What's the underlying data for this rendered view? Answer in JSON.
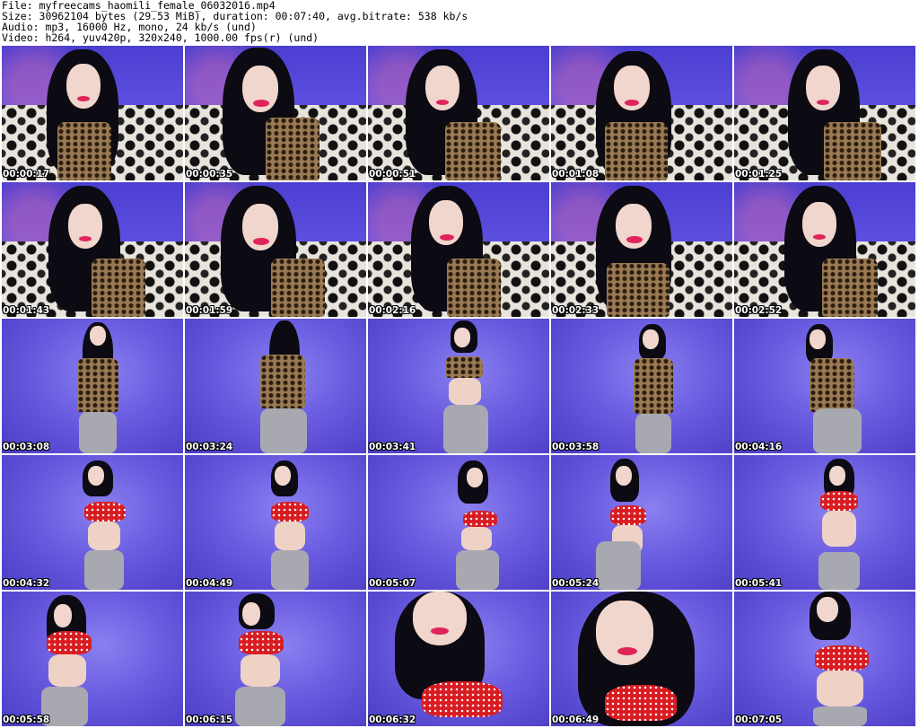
{
  "header": {
    "line1": "File: myfreecams_haomili_female_06032016.mp4",
    "line2": "Size: 30962104 bytes (29.53 MiB), duration: 00:07:40, avg.bitrate: 538 kb/s",
    "line3": "Audio: mp3, 16000 Hz, mono, 24 kb/s (und)",
    "line4": "Video: h264, yuv420p, 320x240, 1000.00 fps(r) (und)"
  },
  "thumbnails": [
    {
      "time": "00:00:17"
    },
    {
      "time": "00:00:35"
    },
    {
      "time": "00:00:51"
    },
    {
      "time": "00:01:08"
    },
    {
      "time": "00:01:25"
    },
    {
      "time": "00:01:43"
    },
    {
      "time": "00:01:59"
    },
    {
      "time": "00:02:16"
    },
    {
      "time": "00:02:33"
    },
    {
      "time": "00:02:52"
    },
    {
      "time": "00:03:08"
    },
    {
      "time": "00:03:24"
    },
    {
      "time": "00:03:41"
    },
    {
      "time": "00:03:58"
    },
    {
      "time": "00:04:16"
    },
    {
      "time": "00:04:32"
    },
    {
      "time": "00:04:49"
    },
    {
      "time": "00:05:07"
    },
    {
      "time": "00:05:24"
    },
    {
      "time": "00:05:41"
    },
    {
      "time": "00:05:58"
    },
    {
      "time": "00:06:15"
    },
    {
      "time": "00:06:32"
    },
    {
      "time": "00:06:49"
    },
    {
      "time": "00:07:05"
    }
  ]
}
